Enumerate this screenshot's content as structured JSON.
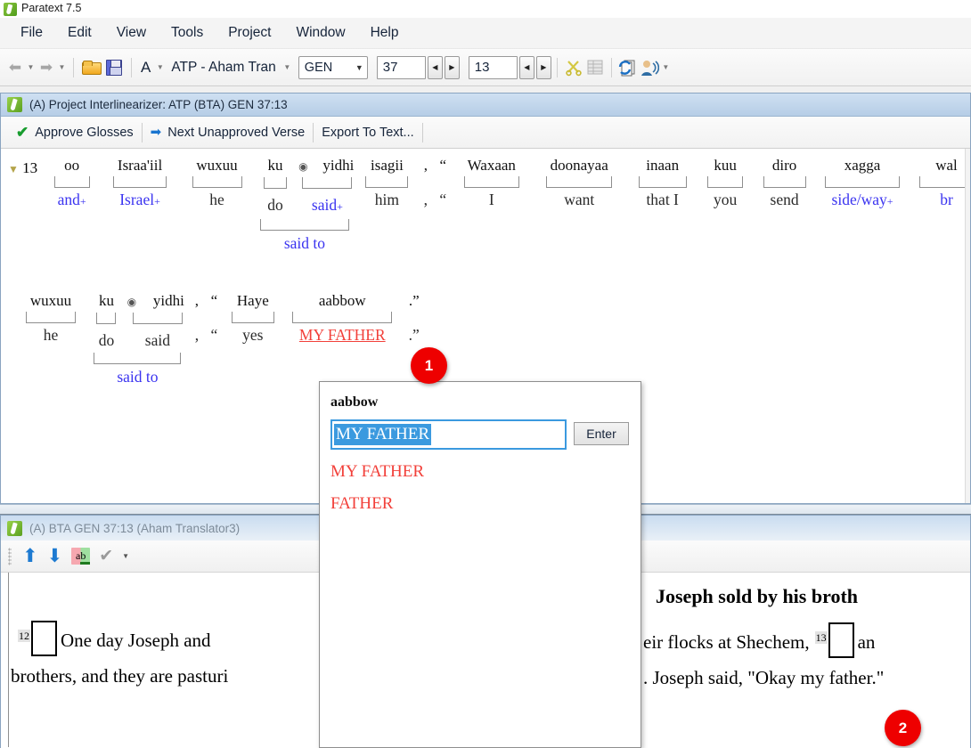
{
  "window": {
    "title": "Paratext 7.5",
    "logo_icon": "paratext-logo-icon"
  },
  "menubar": {
    "items": [
      {
        "label": "File"
      },
      {
        "label": "Edit"
      },
      {
        "label": "View"
      },
      {
        "label": "Tools"
      },
      {
        "label": "Project"
      },
      {
        "label": "Window"
      },
      {
        "label": "Help"
      }
    ]
  },
  "toolbar": {
    "back_icon": "back-arrow-icon",
    "forward_icon": "forward-arrow-icon",
    "open_icon": "open-folder-icon",
    "save_icon": "save-disk-icon",
    "font_label": "A",
    "project_label": "ATP  - Aham Tran",
    "book": "GEN",
    "chapter": "37",
    "verse": "13",
    "scissors_icon": "scissors-icon",
    "table_icon": "table-grid-icon",
    "refresh_icon": "refresh-documents-icon",
    "speaker_icon": "person-speaking-icon"
  },
  "interlinearizer": {
    "caption": "(A) Project Interlinearizer: ATP (BTA) GEN 37:13",
    "caption_icon": "paratext-window-icon",
    "tools": [
      {
        "label": "Approve Glosses",
        "icon": "green-check-icon"
      },
      {
        "label": "Next Unapproved Verse",
        "icon": "blue-arrow-icon"
      },
      {
        "label": "Export To Text...",
        "icon": ""
      }
    ],
    "verse_number": "13",
    "verse_marker_icon": "verse-flag-icon",
    "rows": [
      {
        "cells": [
          {
            "src": "oo",
            "gloss": "and",
            "plus": true,
            "blue": true
          },
          {
            "src": "Israa'iil",
            "gloss": "Israel",
            "plus": true,
            "blue": true
          },
          {
            "src": "wuxuu",
            "gloss": "he",
            "plus": false,
            "blue": false
          },
          {
            "src": "ku",
            "gloss": "do",
            "plus": false,
            "blue": false,
            "dot": true
          },
          {
            "src": "yidhi",
            "gloss": "said",
            "plus": true,
            "blue": true
          },
          {
            "src": "isagii",
            "gloss": "him",
            "plus": false,
            "blue": false
          },
          {
            "src": ",",
            "gloss": ",",
            "punct": true
          },
          {
            "src": "“",
            "gloss": "“",
            "punct": true
          },
          {
            "src": "Waxaan",
            "gloss": "I",
            "plus": false,
            "blue": false
          },
          {
            "src": "doonayaa",
            "gloss": "want",
            "plus": false,
            "blue": false
          },
          {
            "src": "inaan",
            "gloss": "that I",
            "plus": false,
            "blue": false
          },
          {
            "src": "kuu",
            "gloss": "you",
            "plus": false,
            "blue": false
          },
          {
            "src": "diro",
            "gloss": "send",
            "plus": false,
            "blue": false
          },
          {
            "src": "xagga",
            "gloss": "side/way",
            "plus": true,
            "blue": true
          },
          {
            "src": "wal",
            "gloss": "br",
            "plus": false,
            "blue": true
          }
        ],
        "merged": {
          "label": "said to",
          "start": 3,
          "span": 2
        }
      },
      {
        "cells": [
          {
            "src": "wuxuu",
            "gloss": "he",
            "plus": false,
            "blue": false
          },
          {
            "src": "ku",
            "gloss": "do",
            "plus": false,
            "blue": false,
            "dot": true
          },
          {
            "src": "yidhi",
            "gloss": "said",
            "plus": false,
            "blue": false
          },
          {
            "src": ",",
            "gloss": ",",
            "punct": true
          },
          {
            "src": "“",
            "gloss": "“",
            "punct": true
          },
          {
            "src": "Haye",
            "gloss": "yes",
            "plus": false,
            "blue": false
          },
          {
            "src": "aabbow",
            "gloss": "MY FATHER",
            "plus": false,
            "red": true
          },
          {
            "src": ".”",
            "gloss": ".”",
            "punct": true
          }
        ],
        "merged": {
          "label": "said to",
          "start": 1,
          "span": 2
        }
      }
    ]
  },
  "popup": {
    "title": "aabbow",
    "input_value": "MY FATHER",
    "enter_label": "Enter",
    "options": [
      "MY FATHER",
      "FATHER"
    ]
  },
  "editor": {
    "caption": "(A) BTA GEN 37:13 (Aham Translator3)",
    "caption_icon": "paratext-window-icon",
    "tools": [
      {
        "icon": "up-arrow-icon"
      },
      {
        "icon": "down-arrow-icon"
      },
      {
        "icon": "spell-check-ab-icon"
      },
      {
        "icon": "gray-check-icon"
      },
      {
        "icon": "dropdown-caret-icon"
      }
    ],
    "left_column": {
      "verse_number": "12",
      "line1": "One day Joseph and",
      "line2": "brothers, and they are pasturi"
    },
    "right_column": {
      "heading": "Joseph sold by his broth",
      "line1_pre": "eir flocks at Shechem,",
      "verse_number": "13",
      "line1_post": "an",
      "line2": ". Joseph said, \"Okay my father.\""
    }
  },
  "badges": [
    {
      "id": "1",
      "label": "1"
    },
    {
      "id": "2",
      "label": "2"
    }
  ],
  "colors": {
    "gloss_blue": "#3a33f0",
    "gloss_red": "#f2403a",
    "badge_red": "#ee0000",
    "selection_blue": "#3b9adf",
    "caption_blue": "#cfe0f2"
  }
}
